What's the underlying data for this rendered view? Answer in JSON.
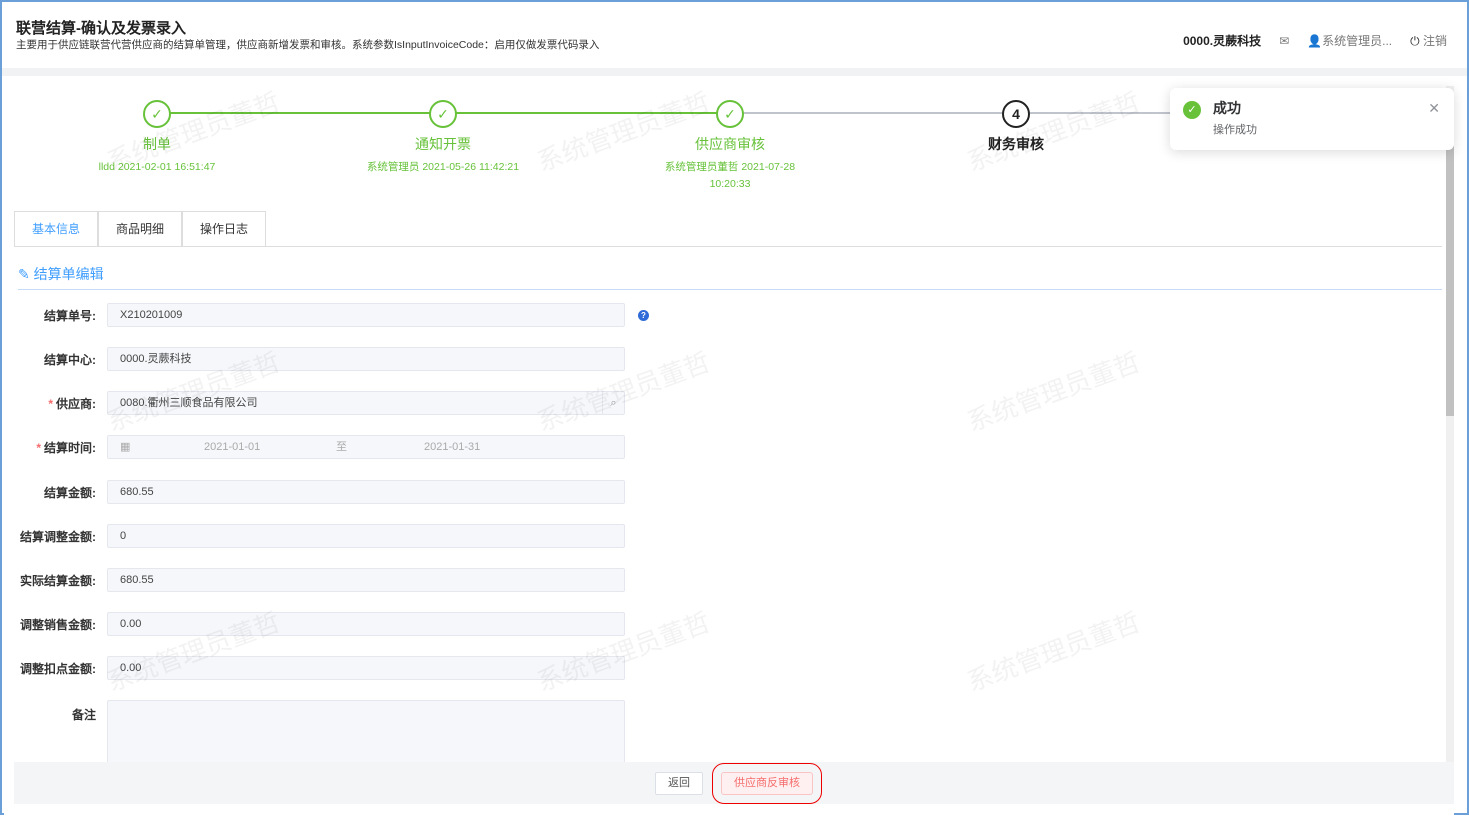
{
  "header": {
    "title": "联营结算-确认及发票录入",
    "subtitle": "主要用于供应链联营代营供应商的结算单管理，供应商新增发票和审核。系统参数IsInputInvoiceCode：启用仅做发票代码录入",
    "org": "0000.灵蕨科技",
    "user": "系统管理员...",
    "logout": "注销"
  },
  "steps": [
    {
      "label": "制单",
      "meta": "lldd 2021-02-01 16:51:47",
      "status": "done"
    },
    {
      "label": "通知开票",
      "meta": "系统管理员 2021-05-26 11:42:21",
      "status": "done"
    },
    {
      "label": "供应商审核",
      "meta": "系统管理员董哲 2021-07-28 10:20:33",
      "status": "done"
    },
    {
      "label": "财务审核",
      "number": "4",
      "status": "current"
    }
  ],
  "tabs": [
    "基本信息",
    "商品明细",
    "操作日志"
  ],
  "section_title": "结算单编辑",
  "form": {
    "settle_no": {
      "label": "结算单号:",
      "value": "X210201009"
    },
    "center": {
      "label": "结算中心:",
      "value": "0000.灵蕨科技"
    },
    "supplier": {
      "label": "供应商:",
      "value": "0080.衢州三顺食品有限公司"
    },
    "period": {
      "label": "结算时间:",
      "start": "2021-01-01",
      "sep": "至",
      "end": "2021-01-31"
    },
    "amount": {
      "label": "结算金额:",
      "value": "680.55"
    },
    "adjust": {
      "label": "结算调整金额:",
      "value": "0"
    },
    "actual": {
      "label": "实际结算金额:",
      "value": "680.55"
    },
    "adj_sales": {
      "label": "调整销售金额:",
      "value": "0.00"
    },
    "adj_points": {
      "label": "调整扣点金额:",
      "value": "0.00"
    },
    "remark": {
      "label": "备注",
      "value": ""
    }
  },
  "buttons": {
    "back": "返回",
    "reverse": "供应商反审核"
  },
  "toast": {
    "title": "成功",
    "message": "操作成功"
  },
  "watermark": "系统管理员董哲",
  "colors": {
    "success": "#67c23a",
    "primary": "#409eff",
    "danger": "#f56c6c"
  }
}
